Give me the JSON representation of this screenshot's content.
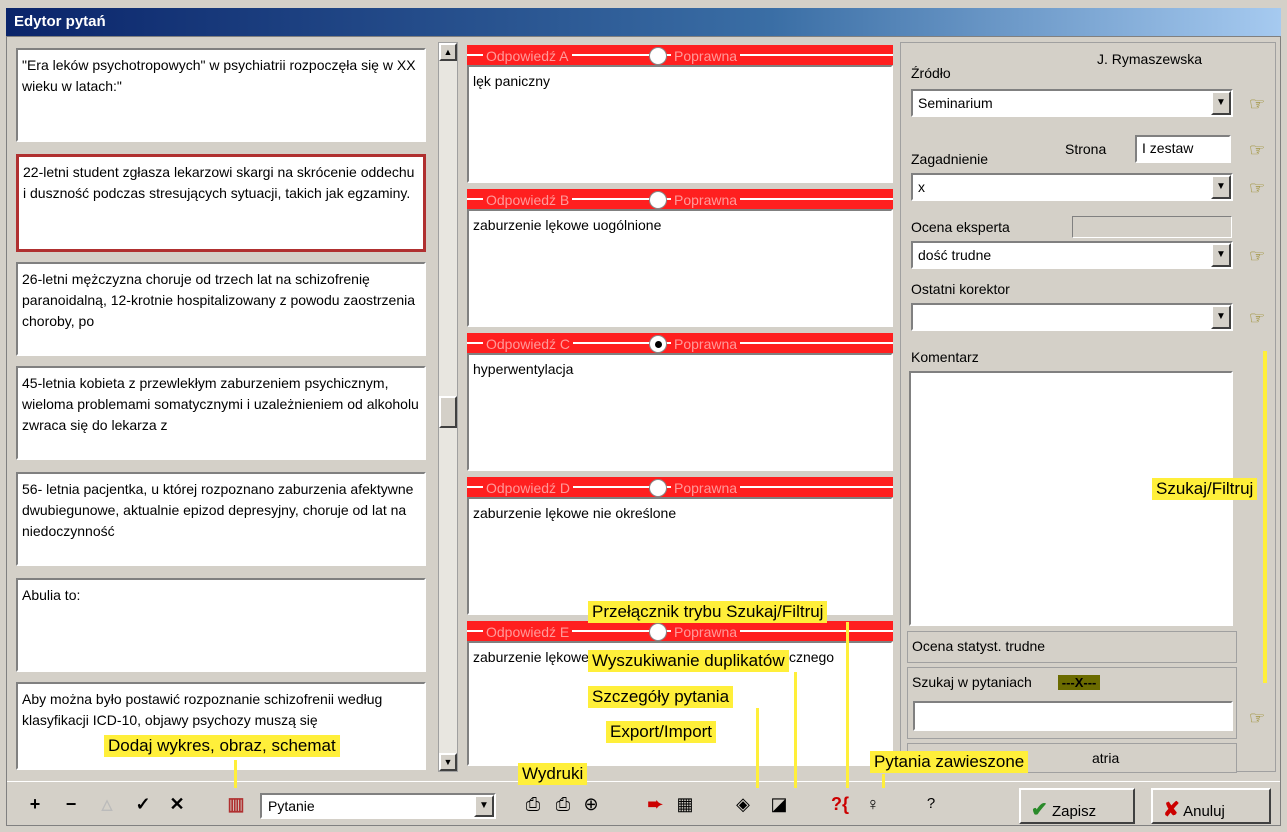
{
  "window": {
    "title": "Edytor pytań"
  },
  "questions": [
    "\"Era leków psychotropowych\" w  psychiatrii rozpoczęła się w XX wieku w latach:\"",
    "22-letni student zgłasza lekarzowi skargi na skrócenie oddechu i duszność podczas stresujących sytuacji, takich jak egzaminy.",
    "26-letni  mężczyzna choruje od trzech lat na schizofrenię paranoidalną, 12-krotnie hospitalizowany z powodu zaostrzenia choroby, po",
    "45-letnia kobieta z przewlekłym zaburzeniem psychicznym, wieloma problemami somatycznymi i uzależnieniem od alkoholu zwraca się do lekarza z",
    "56- letnia pacjentka, u której rozpoznano zaburzenia afektywne dwubiegunowe, aktualnie epizod depresyjny, choruje od lat na niedoczynność",
    "Abulia to:",
    "Aby można było postawić rozpoznanie schizofrenii według klasyfikacji ICD-10, objawy psychozy muszą się"
  ],
  "answers": [
    {
      "label": "Odpowiedź A",
      "correct_label": "Poprawna",
      "selected": false,
      "text": "lęk paniczny"
    },
    {
      "label": "Odpowiedź B",
      "correct_label": "Poprawna",
      "selected": false,
      "text": "zaburzenie lękowe uogólnione"
    },
    {
      "label": "Odpowiedź C",
      "correct_label": "Poprawna",
      "selected": true,
      "text": "hyperwentylacja"
    },
    {
      "label": "Odpowiedź D",
      "correct_label": "Poprawna",
      "selected": false,
      "text": "zaburzenie lękowe nie określone"
    },
    {
      "label": "Odpowiedź E",
      "correct_label": "Poprawna",
      "selected": false,
      "text": "zaburzenie lękowe w przebiegu schorzenia somatycznego"
    }
  ],
  "right": {
    "author": "J. Rymaszewska",
    "zrodlo_label": "Źródło",
    "zrodlo_value": "Seminarium",
    "strona_label": "Strona",
    "strona_value": "I zestaw",
    "zagadnienie_label": "Zagadnienie",
    "zagadnienie_value": "x",
    "ocena_eksperta_label": "Ocena eksperta",
    "ocena_eksperta_value": "dość trudne",
    "korektor_label": "Ostatni korektor",
    "korektor_value": "",
    "komentarz_label": "Komentarz",
    "ocena_statyst": "Ocena statyst. trudne",
    "szukaj_label": "Szukaj w pytaniach",
    "szukaj_marker": "---X---",
    "category_partial": "atria"
  },
  "toolbar": {
    "add": "+",
    "remove": "−",
    "up": "△",
    "ok": "✓",
    "cancel_x": "✕",
    "type_value": "Pytanie",
    "help": "?",
    "save_label": "Zapisz",
    "cancel_label": "Anuluj"
  },
  "callouts": {
    "szukaj_filtruj": "Szukaj/Filtruj",
    "przelacznik": "Przełącznik trybu Szukaj/Filtruj",
    "duplikaty": "Wyszukiwanie duplikatów",
    "szczegoly": "Szczegóły pytania",
    "export": "Export/Import",
    "wydruki": "Wydruki",
    "wykres": "Dodaj wykres, obraz, schemat",
    "zawieszone": "Pytania zawieszone"
  }
}
